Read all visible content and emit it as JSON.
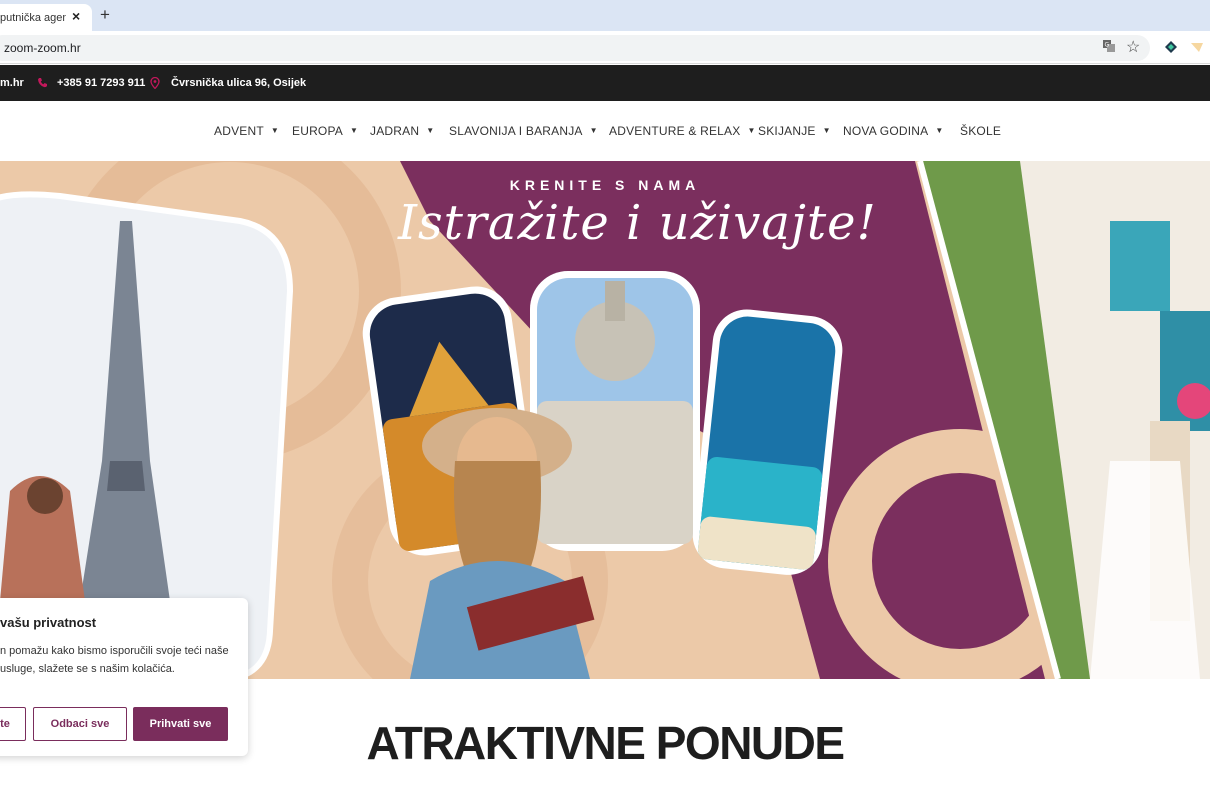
{
  "browser": {
    "tab_title": "putnička agencij",
    "tab_close": "×",
    "new_tab": "+",
    "url": "zoom-zoom.hr"
  },
  "topbar": {
    "email_fragment": "m.hr",
    "phone": "+385 91 7293 911",
    "address": "Čvrsnička ulica 96, Osijek"
  },
  "nav": {
    "items": [
      {
        "label": "ADVENT"
      },
      {
        "label": "EUROPA"
      },
      {
        "label": "JADRAN"
      },
      {
        "label": "SLAVONIJA I BARANJA"
      },
      {
        "label": "ADVENTURE & RELAX"
      },
      {
        "label": "SKIJANJE"
      },
      {
        "label": "NOVA GODINA"
      },
      {
        "label": "ŠKOLE"
      }
    ]
  },
  "hero": {
    "kicker": "KRENITE S NAMA",
    "title": "Istražite i uživajte!"
  },
  "cookie": {
    "title": "vašu privatnost",
    "text": "n pomažu kako bismo isporučili svoje teći naše usluge, slažete se s našim kolačića.",
    "btn_settings": "te",
    "btn_reject": "Odbaci sve",
    "btn_accept": "Prihvati sve"
  },
  "section": {
    "title": "ATRAKTIVNE PONUDE"
  },
  "colors": {
    "brand": "#7a2d5c",
    "hero_plum": "#7b2f5e",
    "hero_peach": "#ecc9a8",
    "topbar": "#1e1e1e"
  }
}
